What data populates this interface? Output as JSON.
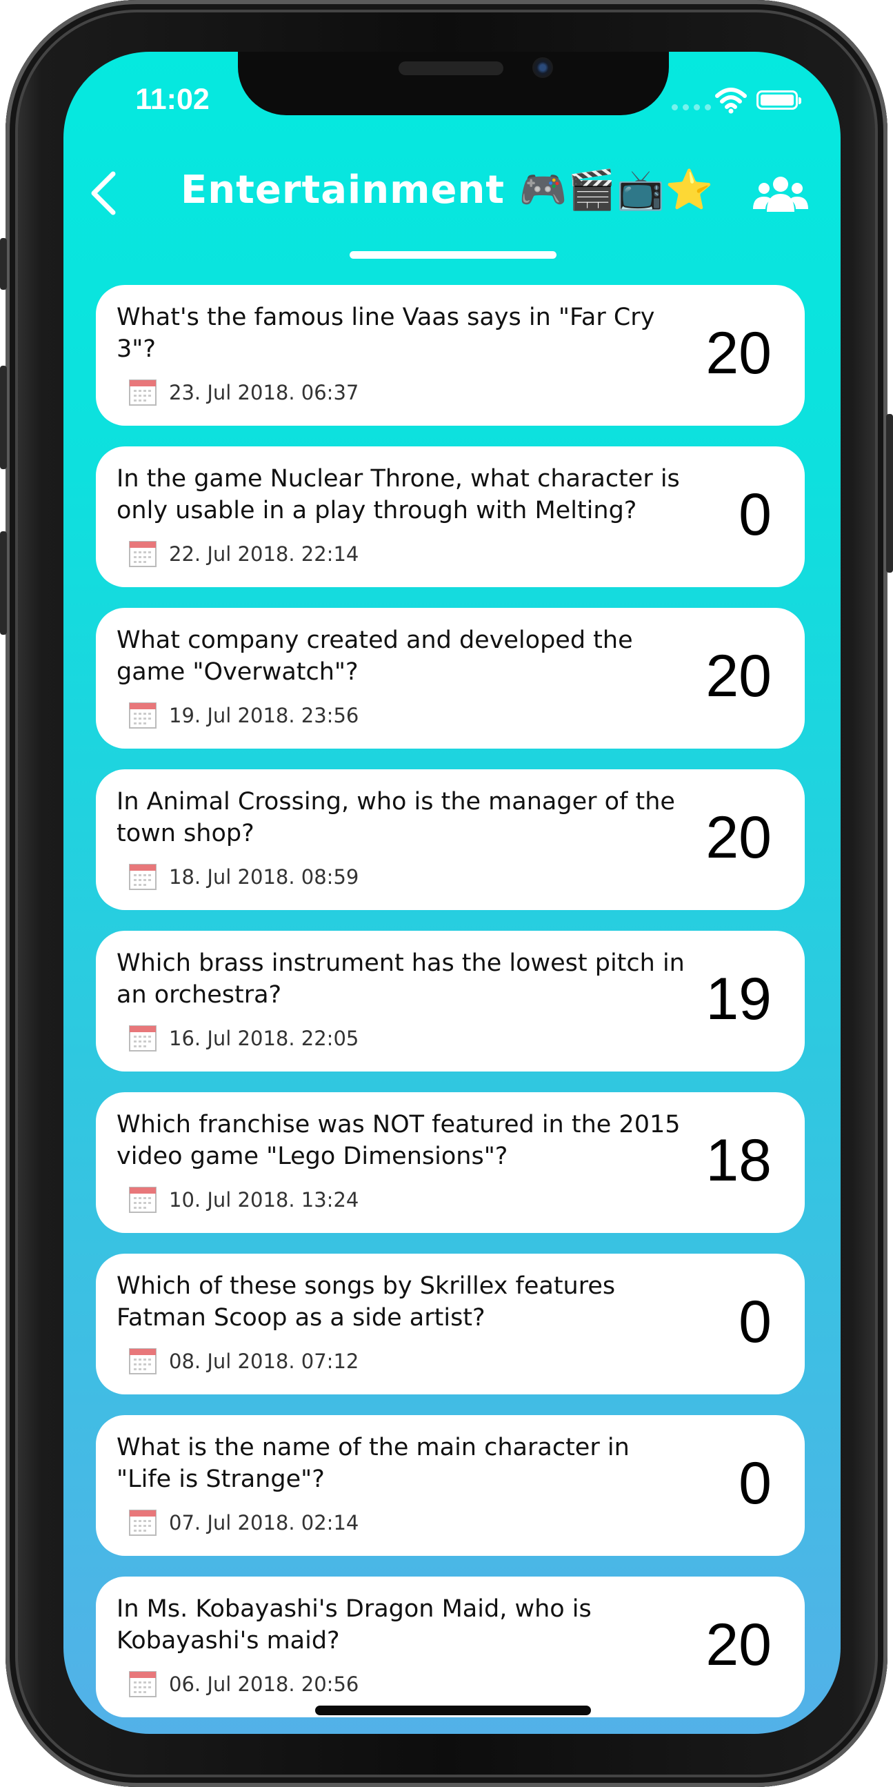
{
  "status_bar": {
    "time": "11:02"
  },
  "nav": {
    "title": "Entertainment 🎮🎬📺⭐",
    "back_icon": "chevron-left-icon",
    "right_icon": "group-users-icon"
  },
  "questions": [
    {
      "text": "What's the famous line Vaas says in \"Far Cry 3\"?",
      "date": "23. Jul 2018. 06:37",
      "score": "20"
    },
    {
      "text": "In the game Nuclear Throne, what character is only usable in a play through with Melting?",
      "date": "22. Jul 2018. 22:14",
      "score": "0"
    },
    {
      "text": "What company created and developed the game \"Overwatch\"?",
      "date": "19. Jul 2018. 23:56",
      "score": "20"
    },
    {
      "text": "In Animal Crossing, who is the manager of the town shop?",
      "date": "18. Jul 2018. 08:59",
      "score": "20"
    },
    {
      "text": "Which brass instrument has the lowest pitch in an orchestra?",
      "date": "16. Jul 2018. 22:05",
      "score": "19"
    },
    {
      "text": "Which franchise was NOT featured in the 2015 video game \"Lego Dimensions\"?",
      "date": "10. Jul 2018. 13:24",
      "score": "18"
    },
    {
      "text": "Which of these songs by Skrillex features Fatman Scoop as a side artist?",
      "date": "08. Jul 2018. 07:12",
      "score": "0"
    },
    {
      "text": "What is the name of the main character in \"Life is Strange\"?",
      "date": "07. Jul 2018. 02:14",
      "score": "0"
    },
    {
      "text": "In Ms. Kobayashi's Dragon Maid, who is Kobayashi's maid?",
      "date": "06. Jul 2018. 20:56",
      "score": "20"
    }
  ]
}
